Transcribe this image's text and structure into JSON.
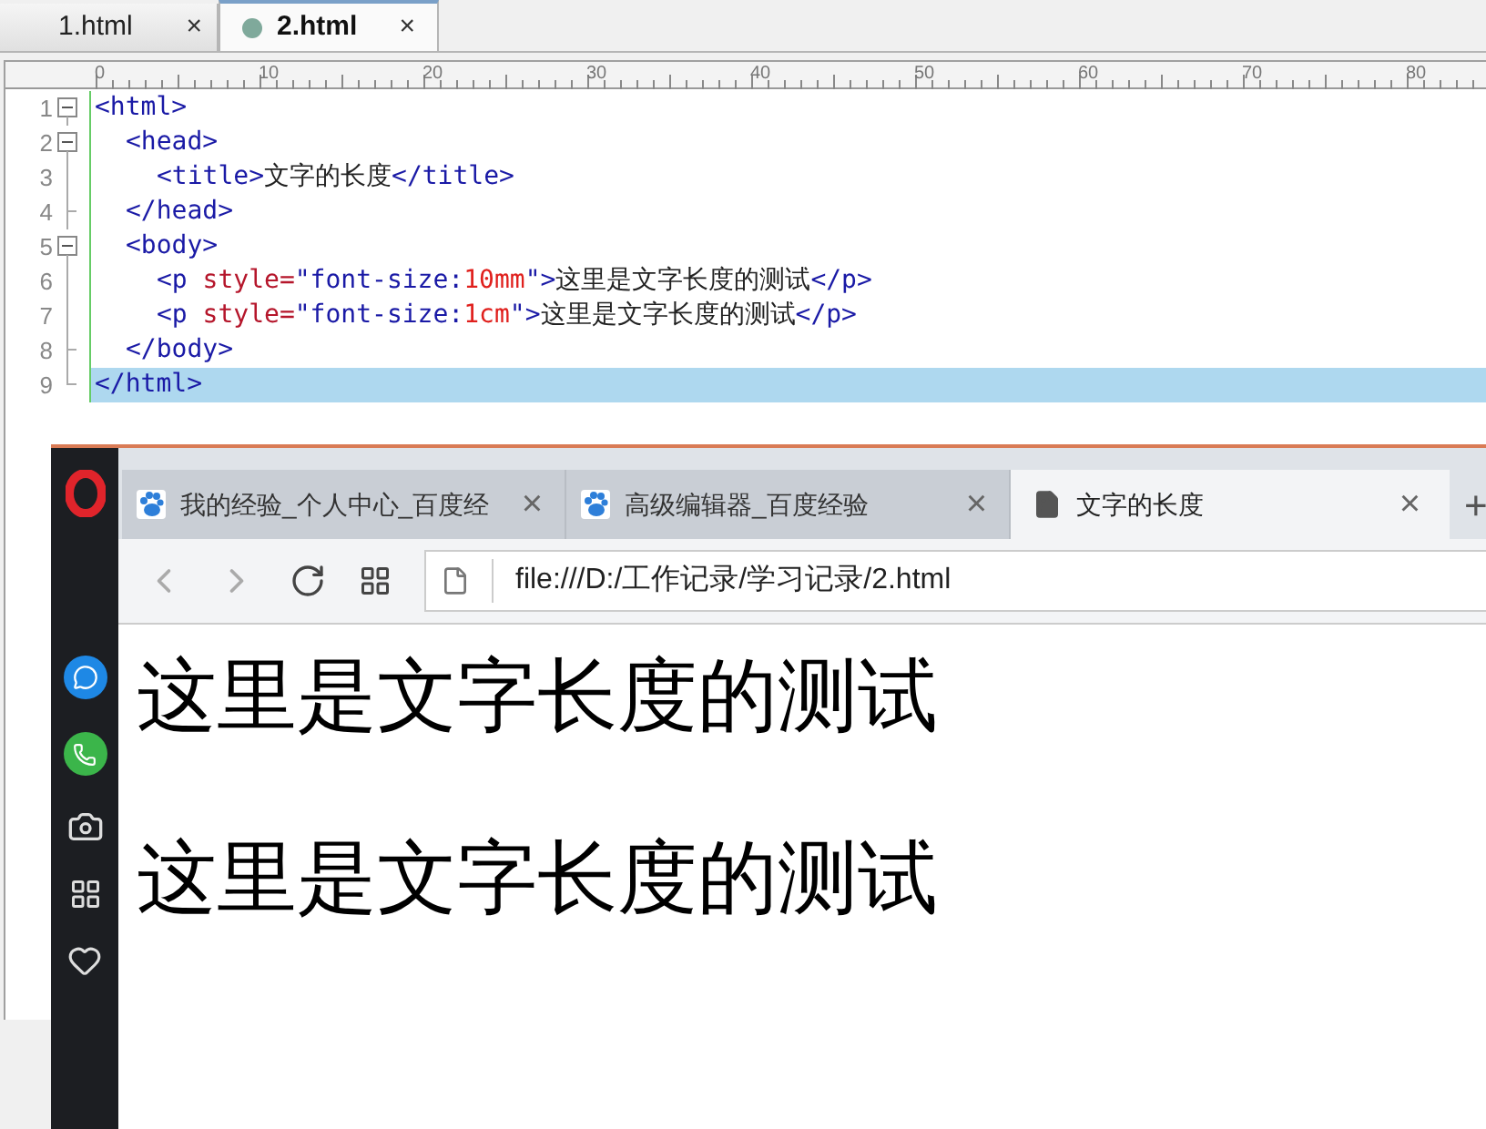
{
  "editor": {
    "tabs": [
      {
        "label": "1.html",
        "selected": false,
        "modified": false,
        "close": "×"
      },
      {
        "label": "2.html",
        "selected": true,
        "modified": true,
        "close": "×"
      }
    ],
    "ruler": [
      "0",
      "10",
      "20",
      "30",
      "40",
      "50",
      "60",
      "70",
      "80"
    ],
    "lines": [
      {
        "number": "1",
        "kind": "open",
        "current": false,
        "tokens": [
          {
            "kind": "tag",
            "text": "<html>"
          }
        ],
        "children": [
          {
            "number": "2",
            "kind": "open",
            "current": false,
            "tokens": [
              {
                "kind": "tag",
                "text": "<head>"
              }
            ],
            "children": [
              {
                "number": "3",
                "kind": "line",
                "current": false,
                "tokens": [
                  {
                    "kind": "tag",
                    "text": "<title>"
                  },
                  {
                    "kind": "text",
                    "text": "文字的长度"
                  },
                  {
                    "kind": "tag",
                    "text": "</title>"
                  }
                ]
              }
            ]
          },
          {
            "number": "4",
            "kind": "end",
            "current": false,
            "tokens": [
              {
                "kind": "tag",
                "text": "</head>"
              }
            ]
          },
          {
            "number": "5",
            "kind": "open",
            "current": false,
            "tokens": [
              {
                "kind": "tag",
                "text": "<body>"
              }
            ],
            "children": [
              {
                "number": "6",
                "kind": "line",
                "current": false,
                "tokens": [
                  {
                    "kind": "tag",
                    "text": "<p "
                  },
                  {
                    "kind": "attr",
                    "text": "style="
                  },
                  {
                    "kind": "value",
                    "text": "\"font-size:"
                  },
                  {
                    "kind": "number",
                    "text": "10mm"
                  },
                  {
                    "kind": "value",
                    "text": "\""
                  },
                  {
                    "kind": "tag",
                    "text": ">"
                  },
                  {
                    "kind": "text",
                    "text": "这里是文字长度的测试"
                  },
                  {
                    "kind": "tag",
                    "text": "</p>"
                  }
                ]
              },
              {
                "number": "7",
                "kind": "line",
                "current": false,
                "tokens": [
                  {
                    "kind": "tag",
                    "text": "<p "
                  },
                  {
                    "kind": "attr",
                    "text": "style="
                  },
                  {
                    "kind": "value",
                    "text": "\"font-size:"
                  },
                  {
                    "kind": "number",
                    "text": "1cm"
                  },
                  {
                    "kind": "value",
                    "text": "\""
                  },
                  {
                    "kind": "tag",
                    "text": ">"
                  },
                  {
                    "kind": "text",
                    "text": "这里是文字长度的测试"
                  },
                  {
                    "kind": "tag",
                    "text": "</p>"
                  }
                ]
              }
            ]
          },
          {
            "number": "8",
            "kind": "end",
            "current": false,
            "tokens": [
              {
                "kind": "tag",
                "text": "</body>"
              }
            ]
          }
        ]
      },
      {
        "number": "9",
        "kind": "last",
        "current": true,
        "tokens": [
          {
            "kind": "tag",
            "text": "</html>"
          }
        ]
      }
    ]
  },
  "browser": {
    "tabs": [
      {
        "label": "我的经验_个人中心_百度经",
        "kind": "paw",
        "selected": false,
        "close": "×"
      },
      {
        "label": "高级编辑器_百度经验",
        "kind": "paw",
        "selected": false,
        "close": "×"
      },
      {
        "label": "文字的长度",
        "kind": "page",
        "selected": true,
        "close": "×"
      }
    ],
    "new_tab": "+",
    "address": "file:///D:/工作记录/学习记录/2.html",
    "paragraphs": [
      "这里是文字长度的测试",
      "这里是文字长度的测试"
    ]
  }
}
